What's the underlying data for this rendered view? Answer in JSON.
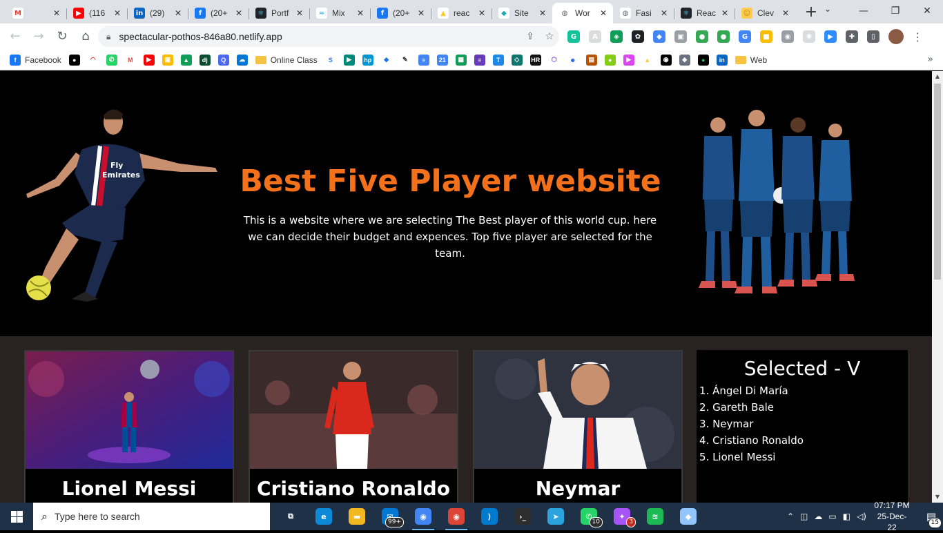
{
  "browser": {
    "tabs": [
      {
        "title": "",
        "icon": "gmail-icon",
        "color": "#ffffff",
        "glyph": "M",
        "glyph_color": "#ea4335"
      },
      {
        "title": "(116",
        "icon": "youtube-icon",
        "color": "#ff0000",
        "glyph": "▶"
      },
      {
        "title": "(29)",
        "icon": "linkedin-icon",
        "color": "#0a66c2",
        "glyph": "in"
      },
      {
        "title": "(20+",
        "icon": "facebook-icon",
        "color": "#1877f2",
        "glyph": "f"
      },
      {
        "title": "Portf",
        "icon": "react-icon",
        "color": "#20232a",
        "glyph": "⚛",
        "glyph_color": "#61dafb"
      },
      {
        "title": "Mix",
        "icon": "tailwind-icon",
        "color": "#ffffff",
        "glyph": "≈",
        "glyph_color": "#38bdf8"
      },
      {
        "title": "(20+",
        "icon": "facebook-icon",
        "color": "#1877f2",
        "glyph": "f"
      },
      {
        "title": "reac",
        "icon": "firebase-icon",
        "color": "#ffffff",
        "glyph": "▲",
        "glyph_color": "#ffca28"
      },
      {
        "title": "Site",
        "icon": "netlify-icon",
        "color": "#ffffff",
        "glyph": "◆",
        "glyph_color": "#20a9b6"
      },
      {
        "title": "Wor",
        "icon": "globe-icon",
        "color": "#ffffff",
        "glyph": "◍",
        "glyph_color": "#5f6368",
        "active": true
      },
      {
        "title": "Fasi",
        "icon": "globe-icon",
        "color": "#ffffff",
        "glyph": "◍",
        "glyph_color": "#5f6368"
      },
      {
        "title": "Reac",
        "icon": "react-icon",
        "color": "#20232a",
        "glyph": "⚛",
        "glyph_color": "#61dafb"
      },
      {
        "title": "Clev",
        "icon": "emoji-icon",
        "color": "#ffcc4d",
        "glyph": "☺",
        "glyph_color": "#b8860b"
      }
    ],
    "new_tab": "+",
    "tab_search": "⌄",
    "window": {
      "minimize": "—",
      "maximize": "❐",
      "close": "✕"
    },
    "nav": {
      "back": "←",
      "forward": "→",
      "reload": "↻",
      "home": "⌂"
    },
    "url": "spectacular-pothos-846a80.netlify.app",
    "omnibox_icons": {
      "share": "⇪",
      "bookmark": "☆"
    },
    "extensions": [
      {
        "icon": "grammarly-icon",
        "color": "#15c39a",
        "glyph": "G"
      },
      {
        "icon": "extension-icon",
        "color": "#dadce0",
        "glyph": "A"
      },
      {
        "icon": "extension-icon",
        "color": "#0f9d58",
        "glyph": "◈"
      },
      {
        "icon": "extension-icon",
        "color": "#202124",
        "glyph": "✿"
      },
      {
        "icon": "extension-icon",
        "color": "#4285f4",
        "glyph": "◆"
      },
      {
        "icon": "extension-icon",
        "color": "#9aa0a6",
        "glyph": "▣"
      },
      {
        "icon": "extension-icon",
        "color": "#34a853",
        "glyph": "●"
      },
      {
        "icon": "extension-icon",
        "color": "#34a853",
        "glyph": "●"
      },
      {
        "icon": "translate-icon",
        "color": "#4285f4",
        "glyph": "G"
      },
      {
        "icon": "extension-icon",
        "color": "#fbbc04",
        "glyph": "■"
      },
      {
        "icon": "camera-icon",
        "color": "#9aa0a6",
        "glyph": "◉"
      },
      {
        "icon": "extension-icon",
        "color": "#dadce0",
        "glyph": "✺"
      },
      {
        "icon": "zoom-icon",
        "color": "#2d8cff",
        "glyph": "▶"
      },
      {
        "icon": "puzzle-icon",
        "color": "#5f6368",
        "glyph": "✚"
      },
      {
        "icon": "sidepanel-icon",
        "color": "#5f6368",
        "glyph": "▯"
      }
    ],
    "menu": "⋮",
    "bookmarks": [
      {
        "label": "Facebook",
        "icon": "facebook-icon",
        "color": "#1877f2",
        "glyph": "f"
      },
      {
        "label": "",
        "icon": "bookmark-icon",
        "color": "#000000",
        "glyph": "●"
      },
      {
        "label": "",
        "icon": "bookmark-icon",
        "color": "#ffffff",
        "glyph": "◠",
        "glyph_color": "#e53935"
      },
      {
        "label": "",
        "icon": "whatsapp-icon",
        "color": "#25d366",
        "glyph": "✆"
      },
      {
        "label": "",
        "icon": "gmail-icon",
        "color": "#ffffff",
        "glyph": "M",
        "glyph_color": "#ea4335"
      },
      {
        "label": "",
        "icon": "youtube-icon",
        "color": "#ff0000",
        "glyph": "▶"
      },
      {
        "label": "",
        "icon": "classroom-icon",
        "color": "#fbbc04",
        "glyph": "▣"
      },
      {
        "label": "",
        "icon": "drive-icon",
        "color": "#0f9d58",
        "glyph": "▲"
      },
      {
        "label": "",
        "icon": "django-icon",
        "color": "#0c4b33",
        "glyph": "dj"
      },
      {
        "label": "",
        "icon": "search-icon",
        "color": "#4e6af0",
        "glyph": "Q"
      },
      {
        "label": "",
        "icon": "cloud-icon",
        "color": "#0078d4",
        "glyph": "☁"
      },
      {
        "label": "Online Class",
        "icon": "folder-icon",
        "folder": true
      },
      {
        "label": "",
        "icon": "bookmark-icon",
        "color": "#ffffff",
        "glyph": "S",
        "glyph_color": "#3b82f6"
      },
      {
        "label": "",
        "icon": "meet-icon",
        "color": "#00897b",
        "glyph": "▶"
      },
      {
        "label": "",
        "icon": "hp-icon",
        "color": "#0096d6",
        "glyph": "hp"
      },
      {
        "label": "",
        "icon": "bookmark-icon",
        "color": "#ffffff",
        "glyph": "◆",
        "glyph_color": "#1a73e8"
      },
      {
        "label": "",
        "icon": "bookmark-icon",
        "color": "#ffffff",
        "glyph": "✎",
        "glyph_color": "#333333"
      },
      {
        "label": "",
        "icon": "docs-icon",
        "color": "#4285f4",
        "glyph": "≡"
      },
      {
        "label": "",
        "icon": "calendar-icon",
        "color": "#4285f4",
        "glyph": "21"
      },
      {
        "label": "",
        "icon": "sheets-icon",
        "color": "#0f9d58",
        "glyph": "▦"
      },
      {
        "label": "",
        "icon": "forms-icon",
        "color": "#673ab7",
        "glyph": "≡"
      },
      {
        "label": "",
        "icon": "bookmark-icon",
        "color": "#1e88e5",
        "glyph": "T"
      },
      {
        "label": "",
        "icon": "bookmark-icon",
        "color": "#0f766e",
        "glyph": "◇"
      },
      {
        "label": "",
        "icon": "bookmark-icon",
        "color": "#111111",
        "glyph": "HR"
      },
      {
        "label": "",
        "icon": "bookmark-icon",
        "color": "#ffffff",
        "glyph": "⬡",
        "glyph_color": "#7c3aed"
      },
      {
        "label": "",
        "icon": "bookmark-icon",
        "color": "#ffffff",
        "glyph": "☻",
        "glyph_color": "#2563eb"
      },
      {
        "label": "",
        "icon": "bookmark-icon",
        "color": "#b45309",
        "glyph": "▤"
      },
      {
        "label": "",
        "icon": "bookmark-icon",
        "color": "#84cc16",
        "glyph": "●"
      },
      {
        "label": "",
        "icon": "bookmark-icon",
        "color": "#d946ef",
        "glyph": "▶"
      },
      {
        "label": "",
        "icon": "firebase-icon",
        "color": "#ffffff",
        "glyph": "▲",
        "glyph_color": "#ffca28"
      },
      {
        "label": "",
        "icon": "github-icon",
        "color": "#000000",
        "glyph": "◉"
      },
      {
        "label": "",
        "icon": "bookmark-icon",
        "color": "#6b7280",
        "glyph": "◆"
      },
      {
        "label": "",
        "icon": "bookmark-icon",
        "color": "#000000",
        "glyph": "●",
        "glyph_color": "#22c55e"
      },
      {
        "label": "",
        "icon": "linkedin-icon",
        "color": "#0a66c2",
        "glyph": "in"
      },
      {
        "label": "Web",
        "icon": "folder-icon",
        "folder": true
      }
    ],
    "bookmarks_more": "»"
  },
  "hero": {
    "title": "Best Five Player website",
    "description": "This is a website where we are selecting The Best player of this world cup. here we can decide their budget and expences. Top five player are selected for the team."
  },
  "players": [
    {
      "name": "Lionel Messi"
    },
    {
      "name": "Cristiano Ronaldo"
    },
    {
      "name": "Neymar"
    }
  ],
  "selected": {
    "title": "Selected - V",
    "items": [
      "1. Ángel Di María",
      "2. Gareth Bale",
      "3. Neymar",
      "4. Cristiano Ronaldo",
      "5. Lionel Messi"
    ]
  },
  "taskbar": {
    "search_placeholder": "Type here to search",
    "apps": [
      {
        "icon": "task-view-icon",
        "color": "#1f3146",
        "glyph": "⧉"
      },
      {
        "icon": "edge-icon",
        "color": "#0c8ad8",
        "glyph": "e"
      },
      {
        "icon": "file-explorer-icon",
        "color": "#f3b81f",
        "glyph": "▬"
      },
      {
        "icon": "mail-icon",
        "color": "#0078d4",
        "glyph": "✉",
        "badge": "99+"
      },
      {
        "icon": "chrome-icon",
        "color": "#4285f4",
        "glyph": "◉",
        "active": true
      },
      {
        "icon": "chrome-icon",
        "color": "#db4437",
        "glyph": "◉",
        "active": true
      },
      {
        "icon": "vscode-icon",
        "color": "#007acc",
        "glyph": "⟩"
      },
      {
        "icon": "terminal-icon",
        "color": "#2d2d2d",
        "glyph": "›_"
      },
      {
        "icon": "telegram-icon",
        "color": "#2aa3df",
        "glyph": "➤"
      },
      {
        "icon": "whatsapp-icon",
        "color": "#25d366",
        "glyph": "✆",
        "badge": "10"
      },
      {
        "icon": "messenger-icon",
        "color": "#a855f7",
        "glyph": "✦",
        "badge": "3",
        "badge_red": true
      },
      {
        "icon": "spotify-icon",
        "color": "#1db954",
        "glyph": "≋"
      },
      {
        "icon": "app-icon",
        "color": "#93c5fd",
        "glyph": "◆"
      }
    ],
    "tray": {
      "chevron": "⌃",
      "time": "07:17 PM",
      "date": "25-Dec-22",
      "notifications": "15"
    }
  }
}
